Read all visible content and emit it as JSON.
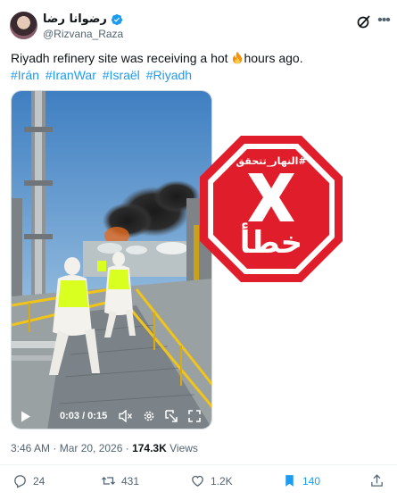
{
  "author": {
    "display_name": "رضوانا رضا",
    "handle": "@Rizvana_Raza",
    "verified": true
  },
  "tweet": {
    "text_before": "Riyadh refinery site was receiving a hot ",
    "emoji": "fire-emoji",
    "text_after": "hours ago.",
    "hashtags": [
      "#Irán",
      "#IranWar",
      "#Israël",
      "#Riyadh"
    ]
  },
  "video": {
    "time": "0:03 / 0:15"
  },
  "fact_check_stamp": {
    "top_text": "#النهار_تتحقق",
    "verdict": "خطأ",
    "color": "#e01e2b"
  },
  "meta": {
    "timestamp": "3:46 AM · Mar 20, 2026 · ",
    "views_count": "174.3K",
    "views_label": " Views"
  },
  "actions": {
    "replies": "24",
    "reposts": "431",
    "likes": "1.2K",
    "bookmarks": "140"
  },
  "colors": {
    "link": "#1d9bf0",
    "text": "#0f1419",
    "muted": "#536471",
    "verified": "#1d9bf0"
  }
}
